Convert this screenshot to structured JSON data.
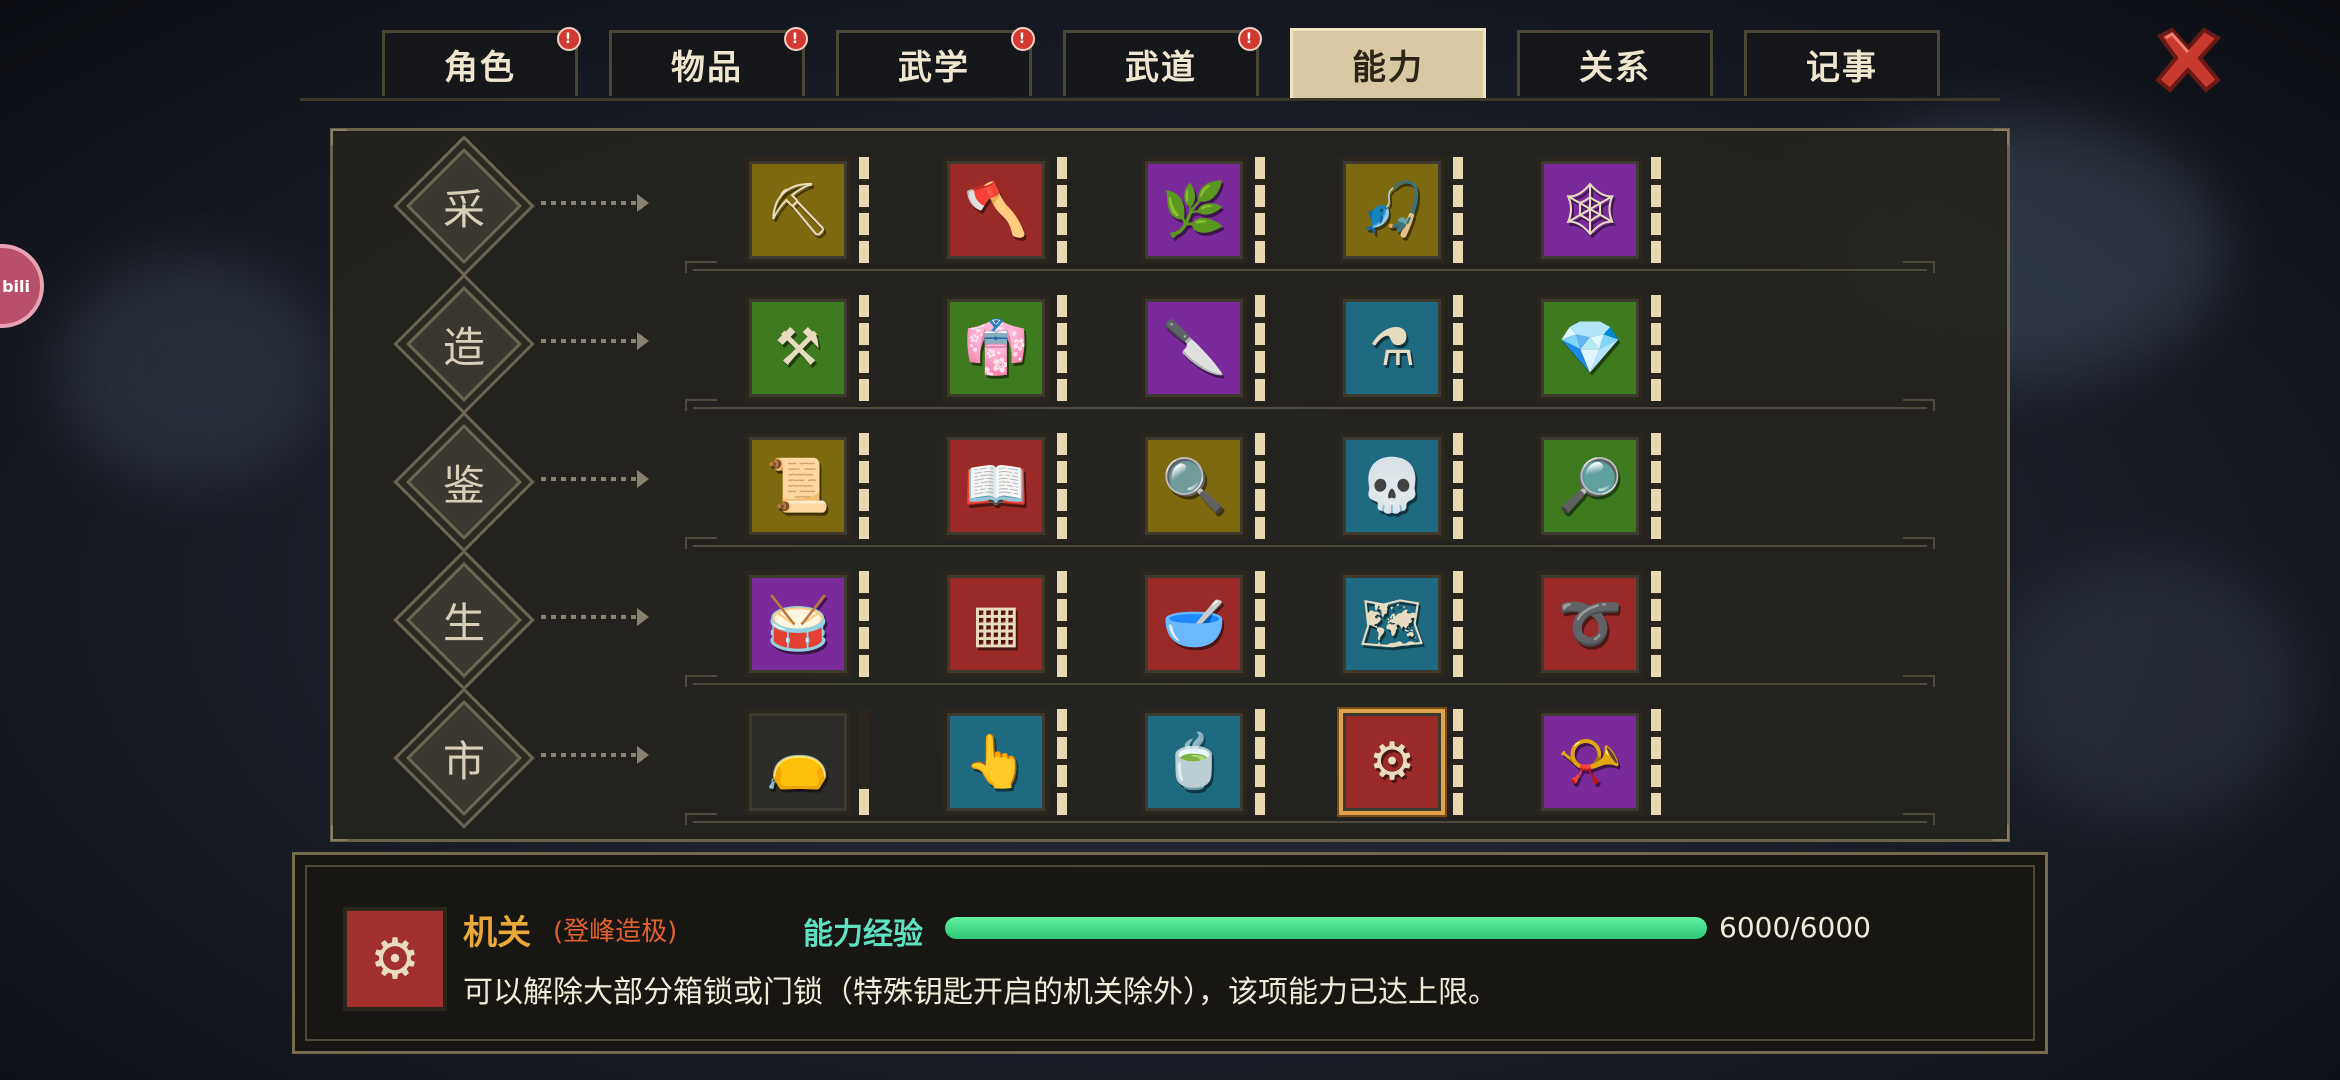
{
  "tabs": [
    {
      "label": "角色",
      "alert": true
    },
    {
      "label": "物品",
      "alert": true
    },
    {
      "label": "武学",
      "alert": true
    },
    {
      "label": "武道",
      "alert": true
    },
    {
      "label": "能力",
      "alert": false,
      "active": true
    },
    {
      "label": "关系",
      "alert": false
    },
    {
      "label": "记事",
      "alert": false
    }
  ],
  "alert_mark": "!",
  "side_badge": "bili",
  "rows": [
    {
      "label": "采",
      "skills": [
        {
          "icon": "ore-pickaxe-icon",
          "glyph": "⛏",
          "bg": "#7d6a10"
        },
        {
          "icon": "axe-log-icon",
          "glyph": "🪓",
          "bg": "#9a2a28"
        },
        {
          "icon": "herb-basket-icon",
          "glyph": "🌿",
          "bg": "#7a2a9a"
        },
        {
          "icon": "fishing-rod-icon",
          "glyph": "🎣",
          "bg": "#7d6a10"
        },
        {
          "icon": "net-icon",
          "glyph": "🕸",
          "bg": "#7a2a9a"
        }
      ]
    },
    {
      "label": "造",
      "skills": [
        {
          "icon": "anvil-icon",
          "glyph": "⚒",
          "bg": "#3e7a1e"
        },
        {
          "icon": "tailoring-icon",
          "glyph": "👘",
          "bg": "#3e7a1e"
        },
        {
          "icon": "cooking-board-icon",
          "glyph": "🔪",
          "bg": "#7a2a9a"
        },
        {
          "icon": "medicine-icon",
          "glyph": "⚗",
          "bg": "#1e6a80"
        },
        {
          "icon": "gem-icon",
          "glyph": "💎",
          "bg": "#3e7a1e"
        }
      ]
    },
    {
      "label": "鉴",
      "skills": [
        {
          "icon": "scroll-magnifier-icon",
          "glyph": "📜",
          "bg": "#7d6a10"
        },
        {
          "icon": "book-magnifier-icon",
          "glyph": "📖",
          "bg": "#9a2a28"
        },
        {
          "icon": "armor-magnifier-icon",
          "glyph": "🔍",
          "bg": "#7d6a10"
        },
        {
          "icon": "skull-magnifier-icon",
          "glyph": "💀",
          "bg": "#1e6a80"
        },
        {
          "icon": "jewel-magnifier-icon",
          "glyph": "🔎",
          "bg": "#3e7a1e"
        }
      ]
    },
    {
      "label": "生",
      "skills": [
        {
          "icon": "drum-icon",
          "glyph": "🥁",
          "bg": "#7a2a9a"
        },
        {
          "icon": "chessboard-icon",
          "glyph": "▦",
          "bg": "#9a2a28"
        },
        {
          "icon": "bowl-icon",
          "glyph": "🥣",
          "bg": "#9a2a28"
        },
        {
          "icon": "map-icon",
          "glyph": "🗺",
          "bg": "#1e6a80"
        },
        {
          "icon": "whip-icon",
          "glyph": "➰",
          "bg": "#9a2a28"
        }
      ]
    },
    {
      "label": "市",
      "skills": [
        {
          "icon": "money-bag-icon",
          "glyph": "👝",
          "bg": "#2e2c28"
        },
        {
          "icon": "pickpocket-hand-icon",
          "glyph": "👆",
          "bg": "#1e6a80"
        },
        {
          "icon": "poison-bowl-icon",
          "glyph": "🍵",
          "bg": "#1e6a80"
        },
        {
          "icon": "mechanism-gear-icon",
          "glyph": "⚙",
          "bg": "#9a2a28",
          "selected": true
        },
        {
          "icon": "horn-icon",
          "glyph": "📯",
          "bg": "#7a2a9a"
        }
      ]
    }
  ],
  "detail": {
    "icon": "mechanism-gear-icon",
    "glyph": "⚙",
    "name": "机关",
    "rank": "(登峰造极)",
    "exp_label": "能力经验",
    "exp_text": "6000/6000",
    "exp_fraction": 1.0,
    "description": "可以解除大部分箱锁或门锁（特殊钥匙开启的机关除外），该项能力已达上限。"
  }
}
